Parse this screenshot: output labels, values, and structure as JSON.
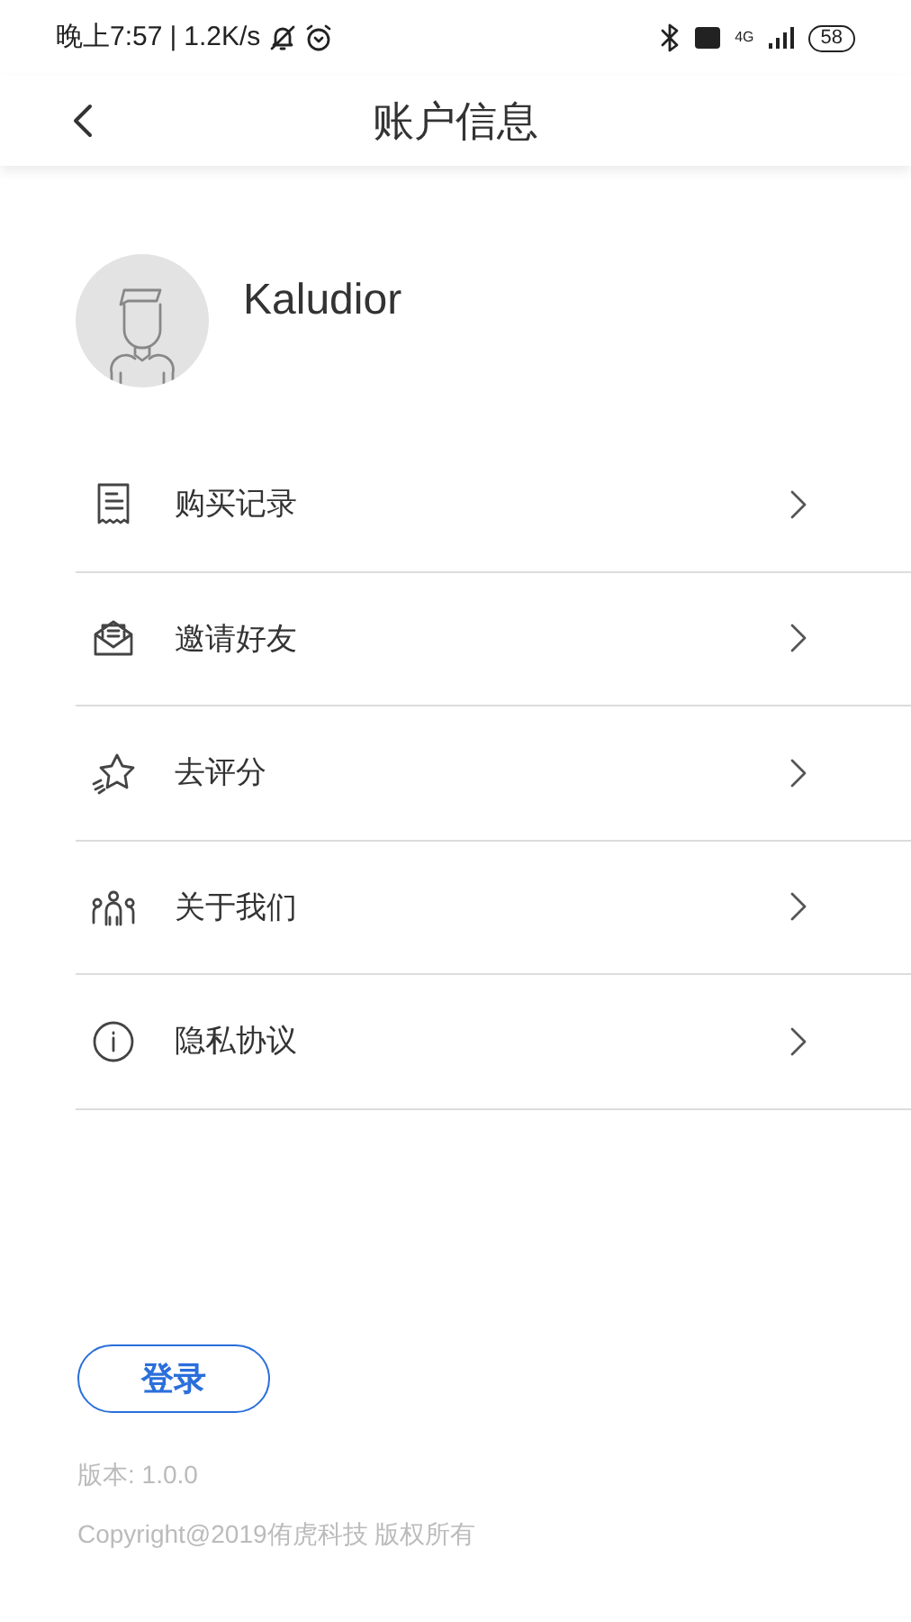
{
  "status_bar": {
    "time": "晚上7:57",
    "separator": "|",
    "speed": "1.2K/s",
    "network": "4G",
    "battery": "58"
  },
  "header": {
    "title": "账户信息"
  },
  "profile": {
    "name": "Kaludior"
  },
  "menu": [
    {
      "kind": "receipt",
      "label": "购买记录"
    },
    {
      "kind": "invite",
      "label": "邀请好友"
    },
    {
      "kind": "rate",
      "label": "去评分"
    },
    {
      "kind": "team",
      "label": "关于我们"
    },
    {
      "kind": "info",
      "label": "隐私协议"
    }
  ],
  "login_button": "登录",
  "version": "版本: 1.0.0",
  "copyright": "Copyright@2019侑虎科技 版权所有"
}
